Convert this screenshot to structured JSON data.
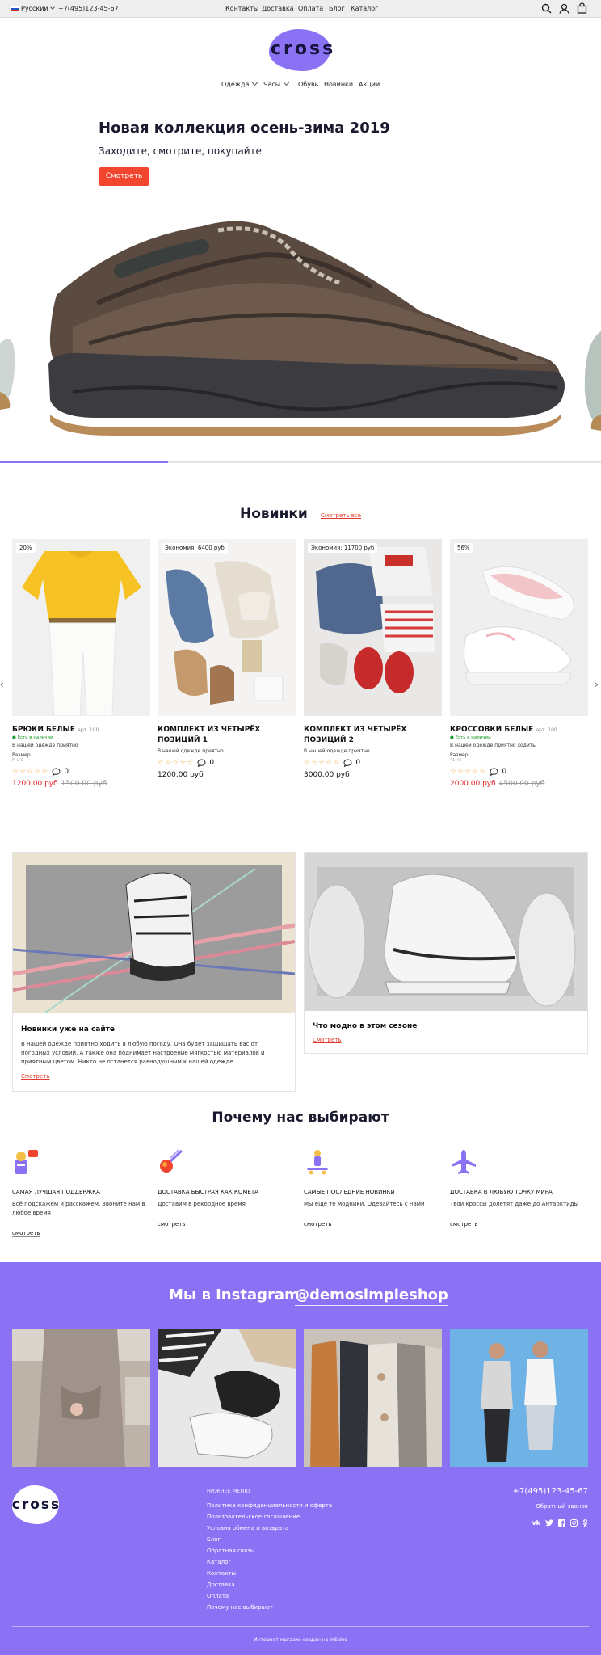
{
  "topbar": {
    "language": "Русский",
    "phone": "+7(495)123-45-67",
    "links": [
      "Контакты",
      "Доставка",
      "Оплата",
      "Блог",
      "Каталог"
    ],
    "icons": [
      "search-icon",
      "user-icon",
      "cart-icon"
    ]
  },
  "logo": {
    "text": "cross"
  },
  "nav": [
    "Одежда",
    "Часы",
    "Обувь",
    "Новинки",
    "Акции"
  ],
  "hero": {
    "title": "Новая коллекция осень-зима 2019",
    "subtitle": "Заходите, смотрите, покупайте",
    "button": "Смотреть",
    "slider_progress": 0.28
  },
  "new_items": {
    "title": "Новинки",
    "see_all": "Смотреть все",
    "products": [
      {
        "badge": "20%",
        "title": "БРЮКИ БЕЛЫЕ",
        "art": "арт. 100",
        "availability": "Есть в наличии",
        "tagline": "В нашей одежде приятно",
        "size_label": "Размер",
        "sizes": "M L S",
        "reviews": "0",
        "price": "1200.00 руб",
        "old_price": "1500.00 руб"
      },
      {
        "badge": "Экономия: 6400 руб",
        "title": "КОМПЛЕКТ ИЗ ЧЕТЫРЁХ ПОЗИЦИЙ 1",
        "art": "",
        "availability": "",
        "tagline": "В нашей одежде приятно",
        "size_label": "",
        "sizes": "",
        "reviews": "0",
        "price": "1200.00 руб",
        "old_price": ""
      },
      {
        "badge": "Экономия: 11700 руб",
        "title": "КОМПЛЕКТ ИЗ ЧЕТЫРЁХ ПОЗИЦИЙ 2",
        "art": "",
        "availability": "",
        "tagline": "В нашей одежде приятно",
        "size_label": "",
        "sizes": "",
        "reviews": "0",
        "price": "3000.00 руб",
        "old_price": ""
      },
      {
        "badge": "56%",
        "title": "КРОССОВКИ БЕЛЫЕ",
        "art": "арт. 100",
        "availability": "Есть в наличии",
        "tagline": "В нашей одежде приятно ходить",
        "size_label": "Размер",
        "sizes": "41 42",
        "reviews": "0",
        "price": "2000.00 руб",
        "old_price": "4500.00 руб"
      }
    ]
  },
  "banners": [
    {
      "title": "Новинки уже на сайте",
      "text": "В нашей одежде приятно ходить в любую погоду. Она будет защищать вас от погодных условий. А также она поднимает настроение мягкостью материалов и приятным цветом. Никто не останется равнодушным к нашей одежде.",
      "link": "Смотреть"
    },
    {
      "title": "Что модно в этом сезоне",
      "text": "",
      "link": "Смотреть"
    }
  ],
  "why": {
    "title": "Почему нас выбирают",
    "items": [
      {
        "icon": "support-icon",
        "title": "САМАЯ ЛУЧШАЯ ПОДДЕРЖКА",
        "text": "Всё подскажем и расскажем. Звоните нам в любое время",
        "link": "смотреть"
      },
      {
        "icon": "comet-icon",
        "title": "ДОСТАВКА БЫСТРАЯ КАК КОМЕТА",
        "text": "Доставим в рекордное время",
        "link": "смотреть"
      },
      {
        "icon": "skateboard-icon",
        "title": "САМЫЕ ПОСЛЕДНИЕ НОВИНКИ",
        "text": "Мы еще те модники. Одевайтесь с нами",
        "link": "смотреть"
      },
      {
        "icon": "plane-icon",
        "title": "ДОСТАВКА В ЛЮБУЮ ТОЧКУ МИРА",
        "text": "Твои кроссы долетят даже до Антарктиды",
        "link": "смотреть"
      }
    ]
  },
  "instagram": {
    "title": "Мы в Instagram",
    "handle": "@demosimpleshop"
  },
  "footer": {
    "menu_title": "НИЖНЕЕ МЕНЮ",
    "menu": [
      "Политика конфиденциальности и оферта",
      "Пользовательское соглашение",
      "Условия обмена и возврата",
      "Блог",
      "Обратная связь",
      "Каталог",
      "Контакты",
      "Доставка",
      "Оплата",
      "Почему нас выбирают"
    ],
    "phone": "+7(495)123-45-67",
    "callback": "Обратный звонок",
    "social": [
      "vk-icon",
      "twitter-icon",
      "facebook-icon",
      "instagram-icon",
      "odnoklassniki-icon"
    ],
    "copyright": "Интернет-магазин создан на InSales"
  },
  "colors": {
    "accent": "#8b72f4",
    "red": "#f2452d",
    "dark": "#1a1a2e"
  }
}
